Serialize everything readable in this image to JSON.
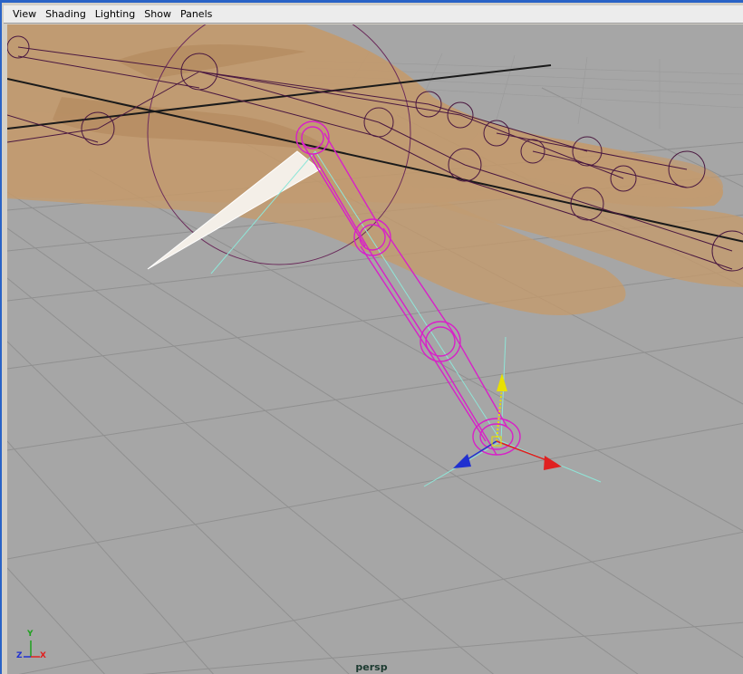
{
  "menubar": {
    "items": [
      "View",
      "Shading",
      "Lighting",
      "Show",
      "Panels"
    ]
  },
  "viewport": {
    "camera_label": "persp"
  },
  "axis_indicator": {
    "labels": {
      "x": "X",
      "y": "Y",
      "z": "Z"
    },
    "colors": {
      "x": "#e02020",
      "y": "#1fa01f",
      "z": "#2030d0"
    }
  },
  "colors": {
    "window_border": "#2a63c6",
    "viewport_bg": "#a6a6a6",
    "grid": "#8a8a8a",
    "hand_skin": "#c79c6c",
    "joint_selected": "#d820c8",
    "joint_default": "#5a1a4a",
    "manipulator_x": "#e02020",
    "manipulator_y": "#e8e000",
    "manipulator_z": "#2030d0",
    "ik_handle": "#8fe6d8"
  },
  "icons": {
    "move_manipulator": "move-manipulator-icon",
    "axis_gizmo": "axis-gizmo-icon"
  }
}
